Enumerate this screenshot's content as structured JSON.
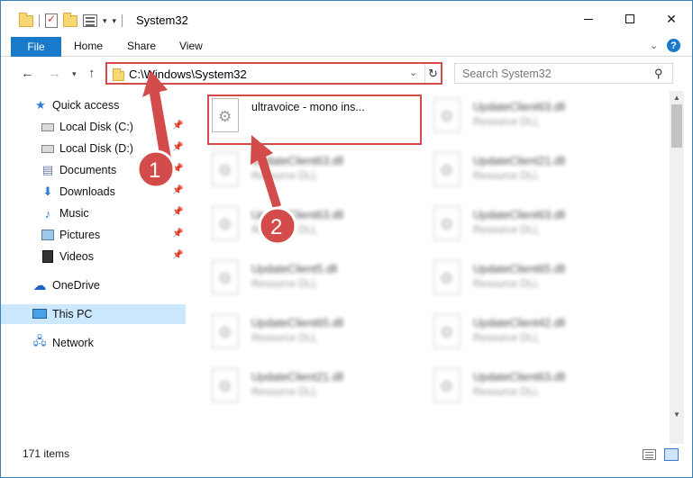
{
  "window": {
    "title": "System32"
  },
  "ribbon": {
    "tabs": [
      "File",
      "Home",
      "Share",
      "View"
    ]
  },
  "address": {
    "path": "C:\\Windows\\System32",
    "search_placeholder": "Search System32"
  },
  "nav": {
    "items": [
      {
        "label": "Quick access",
        "icon": "star-icon"
      },
      {
        "label": "Local Disk (C:)",
        "icon": "drive-icon",
        "pinned": true
      },
      {
        "label": "Local Disk (D:)",
        "icon": "drive-icon",
        "pinned": true
      },
      {
        "label": "Documents",
        "icon": "documents-icon",
        "pinned": true
      },
      {
        "label": "Downloads",
        "icon": "downloads-icon",
        "pinned": true
      },
      {
        "label": "Music",
        "icon": "music-icon",
        "pinned": true
      },
      {
        "label": "Pictures",
        "icon": "pictures-icon",
        "pinned": true
      },
      {
        "label": "Videos",
        "icon": "videos-icon",
        "pinned": true
      },
      {
        "label": "OneDrive",
        "icon": "onedrive-icon"
      },
      {
        "label": "This PC",
        "icon": "pc-icon",
        "selected": true
      },
      {
        "label": "Network",
        "icon": "network-icon"
      }
    ]
  },
  "files": [
    {
      "name": "ultravoice - mono ins...",
      "type": ""
    },
    {
      "name": "UpdateClient63.dll",
      "type": "Resource DLL"
    },
    {
      "name": "UpdateClient63.dll",
      "type": "Resource DLL"
    },
    {
      "name": "UpdateClient21.dll",
      "type": "Resource DLL"
    },
    {
      "name": "UpdateClient63.dll",
      "type": "Resource DLL"
    },
    {
      "name": "UpdateClient63.dll",
      "type": "Resource DLL"
    },
    {
      "name": "UpdateClient5.dll",
      "type": "Resource DLL"
    },
    {
      "name": "UpdateClient65.dll",
      "type": "Resource DLL"
    },
    {
      "name": "UpdateClient65.dll",
      "type": "Resource DLL"
    },
    {
      "name": "UpdateClient42.dll",
      "type": "Resource DLL"
    },
    {
      "name": "UpdateClient21.dll",
      "type": "Resource DLL"
    },
    {
      "name": "UpdateClient63.dll",
      "type": "Resource DLL"
    }
  ],
  "status": {
    "item_count": "171 items"
  },
  "annotations": {
    "step1": "1",
    "step2": "2",
    "color": "#d34b4b"
  }
}
